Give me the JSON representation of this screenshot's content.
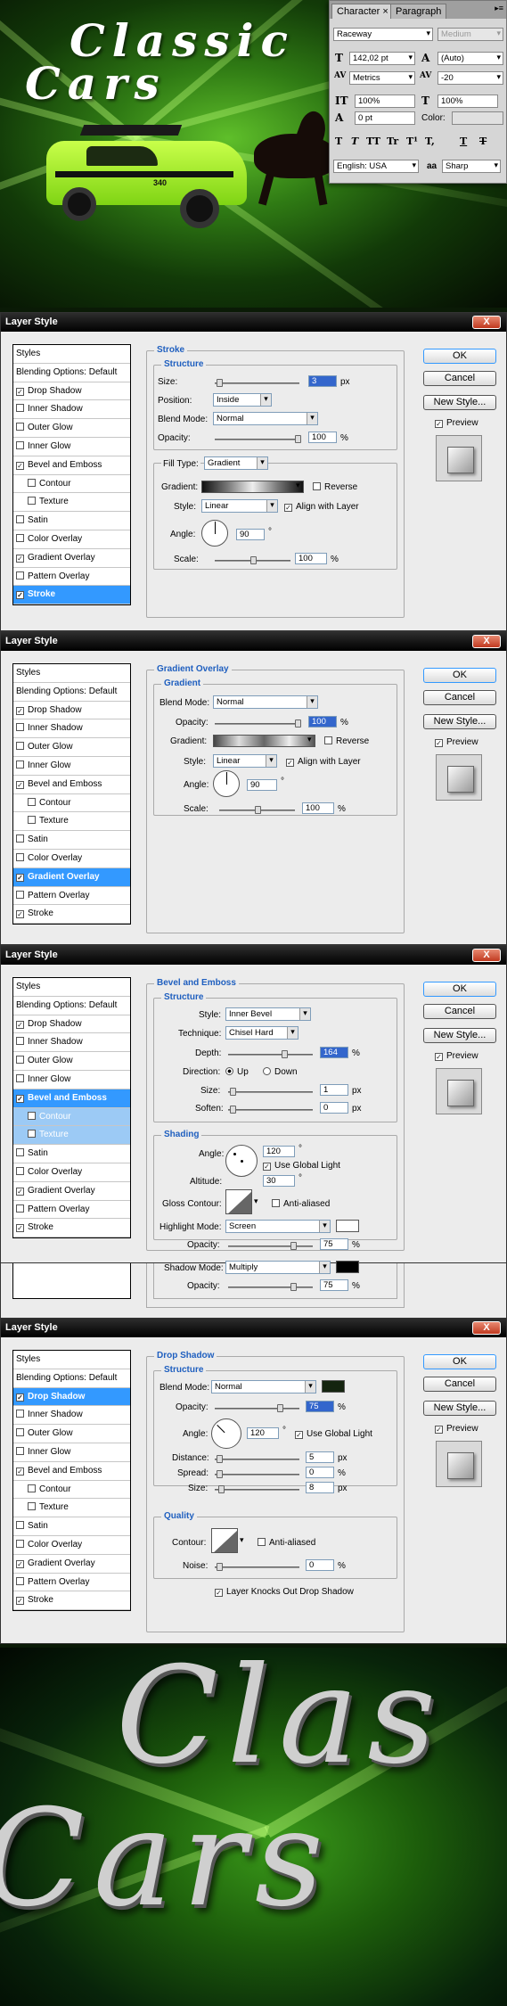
{
  "hero": {
    "title_line1": "Classic",
    "title_line2": "Cars",
    "car_badge": "340"
  },
  "character_panel": {
    "tabs": [
      "Character",
      "Paragraph"
    ],
    "font_family": "Raceway",
    "font_style": "Medium",
    "font_size": "142,02 pt",
    "leading": "(Auto)",
    "kerning": "Metrics",
    "tracking": "-20",
    "vertical_scale": "100%",
    "horizontal_scale": "100%",
    "baseline_shift": "0 pt",
    "color_label": "Color:",
    "style_buttons": [
      "T",
      "T",
      "TT",
      "Tr",
      "T¹",
      "T,",
      "T",
      "T"
    ],
    "language": "English: USA",
    "aa_label": "aa",
    "antialias": "Sharp"
  },
  "common": {
    "title": "Layer Style",
    "close": "X",
    "styles_header": "Styles",
    "blending": "Blending Options: Default",
    "ok": "OK",
    "cancel": "Cancel",
    "new_style": "New Style...",
    "preview": "Preview"
  },
  "style_items": [
    "Drop Shadow",
    "Inner Shadow",
    "Outer Glow",
    "Inner Glow",
    "Bevel and Emboss",
    "Contour",
    "Texture",
    "Satin",
    "Color Overlay",
    "Gradient Overlay",
    "Pattern Overlay",
    "Stroke"
  ],
  "stroke": {
    "title": "Stroke",
    "structure": "Structure",
    "size_label": "Size:",
    "size_value": "3",
    "size_unit": "px",
    "position_label": "Position:",
    "position_value": "Inside",
    "blend_label": "Blend Mode:",
    "blend_value": "Normal",
    "opacity_label": "Opacity:",
    "opacity_value": "100",
    "pct": "%",
    "fill_type_label": "Fill Type:",
    "fill_type_value": "Gradient",
    "gradient_label": "Gradient:",
    "reverse": "Reverse",
    "style_label": "Style:",
    "style_value": "Linear",
    "align": "Align with Layer",
    "angle_label": "Angle:",
    "angle_value": "90",
    "deg": "°",
    "scale_label": "Scale:",
    "scale_value": "100"
  },
  "gradient_overlay": {
    "title": "Gradient Overlay",
    "sub": "Gradient",
    "blend_label": "Blend Mode:",
    "blend_value": "Normal",
    "opacity_label": "Opacity:",
    "opacity_value": "100",
    "gradient_label": "Gradient:",
    "reverse": "Reverse",
    "style_label": "Style:",
    "style_value": "Linear",
    "align": "Align with Layer",
    "angle_label": "Angle:",
    "angle_value": "90",
    "scale_label": "Scale:",
    "scale_value": "100"
  },
  "bevel": {
    "title": "Bevel and Emboss",
    "structure": "Structure",
    "style_label": "Style:",
    "style_value": "Inner Bevel",
    "technique_label": "Technique:",
    "technique_value": "Chisel Hard",
    "depth_label": "Depth:",
    "depth_value": "164",
    "direction_label": "Direction:",
    "up": "Up",
    "down": "Down",
    "size_label": "Size:",
    "size_value": "1",
    "soften_label": "Soften:",
    "soften_value": "0",
    "px": "px",
    "shading": "Shading",
    "angle_label": "Angle:",
    "angle_value": "120",
    "global_light": "Use Global Light",
    "altitude_label": "Altitude:",
    "altitude_value": "30",
    "gloss_label": "Gloss Contour:",
    "anti": "Anti-aliased",
    "hl_label": "Highlight Mode:",
    "hl_value": "Screen",
    "opacity_label": "Opacity:",
    "hl_opacity": "75",
    "sh_label": "Shadow Mode:",
    "sh_value": "Multiply",
    "sh_opacity": "75"
  },
  "drop_shadow": {
    "title": "Drop Shadow",
    "structure": "Structure",
    "blend_label": "Blend Mode:",
    "blend_value": "Normal",
    "opacity_label": "Opacity:",
    "opacity_value": "75",
    "angle_label": "Angle:",
    "angle_value": "120",
    "global_light": "Use Global Light",
    "distance_label": "Distance:",
    "distance_value": "5",
    "spread_label": "Spread:",
    "spread_value": "0",
    "size_label": "Size:",
    "size_value": "8",
    "px": "px",
    "quality": "Quality",
    "contour_label": "Contour:",
    "anti": "Anti-aliased",
    "noise_label": "Noise:",
    "noise_value": "0",
    "knocks": "Layer Knocks Out Drop Shadow"
  },
  "art": {
    "line1": "Clas",
    "line2": "Cars"
  },
  "colors": {
    "accent": "#3399ff",
    "section_title": "#1f5fbf",
    "close_red": "#c0391f",
    "hero_green": "#5fbf2a",
    "shadow_swatch": "#14240f"
  }
}
